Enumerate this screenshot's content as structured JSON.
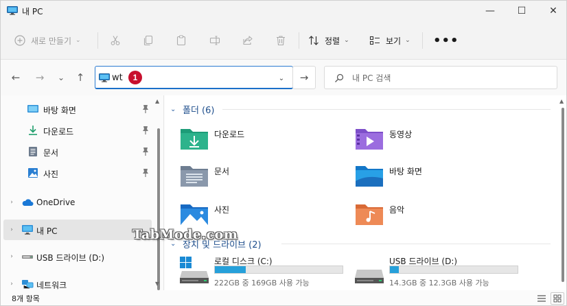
{
  "window": {
    "title": "내 PC",
    "minimize_glyph": "—",
    "maximize_glyph": "☐",
    "close_glyph": "✕"
  },
  "toolbar": {
    "new_label": "새로 만들기",
    "sort_label": "정렬",
    "view_label": "보기",
    "more_glyph": "•••",
    "icons": [
      "cut-icon",
      "copy-icon",
      "paste-icon",
      "rename-icon",
      "share-icon",
      "delete-icon"
    ]
  },
  "nav": {
    "back_glyph": "←",
    "forward_glyph": "→",
    "recent_glyph": "⌄",
    "up_glyph": "↑",
    "address_value": "wt",
    "annotation_number": "1",
    "go_glyph": "→",
    "search_placeholder": "내 PC 검색"
  },
  "sidebar": {
    "items": [
      {
        "label": "바탕 화면",
        "pinned": true
      },
      {
        "label": "다운로드",
        "pinned": true
      },
      {
        "label": "문서",
        "pinned": true
      },
      {
        "label": "사진",
        "pinned": true
      },
      {
        "label": "OneDrive",
        "expandable": true
      },
      {
        "label": "내 PC",
        "expandable": true,
        "selected": true
      },
      {
        "label": "USB 드라이브 (D:)",
        "expandable": true
      },
      {
        "label": "네트워크",
        "expandable": true
      }
    ]
  },
  "content": {
    "folders_header": "폴더 (6)",
    "folders": [
      {
        "label": "다운로드",
        "icon": "downloads-folder-icon"
      },
      {
        "label": "동영상",
        "icon": "videos-folder-icon"
      },
      {
        "label": "문서",
        "icon": "documents-folder-icon"
      },
      {
        "label": "바탕 화면",
        "icon": "desktop-folder-icon"
      },
      {
        "label": "사진",
        "icon": "pictures-folder-icon"
      },
      {
        "label": "음악",
        "icon": "music-folder-icon"
      }
    ],
    "drives_header": "장치 및 드라이브 (2)",
    "drives": [
      {
        "label": "로컬 디스크 (C:)",
        "detail": "222GB 중 169GB 사용 가능",
        "used_fraction": 0.24,
        "icon": "windows-drive-icon"
      },
      {
        "label": "USB 드라이브 (D:)",
        "detail": "14.3GB 중 12.3GB 사용 가능",
        "used_fraction": 0.07,
        "icon": "usb-drive-icon"
      }
    ]
  },
  "status": {
    "item_count": "8개 항목"
  },
  "watermark": "TabMode.com",
  "colors": {
    "accent": "#2a7ad1",
    "annotation_badge": "#c8102e",
    "drive_bar": "#26a0da"
  }
}
